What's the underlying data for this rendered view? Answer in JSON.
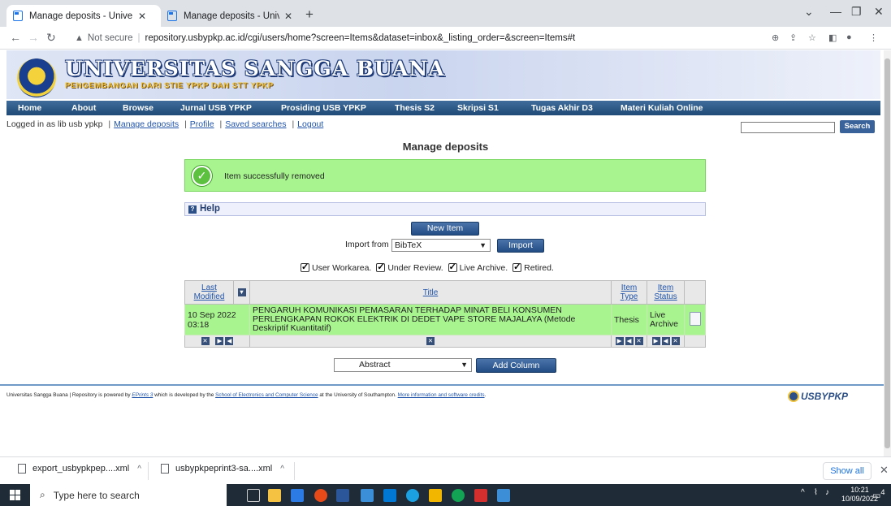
{
  "browser": {
    "tabs": [
      {
        "label": "Manage deposits - Universitas Sa",
        "active": true
      },
      {
        "label": "Manage deposits - Universitas Sa",
        "active": false
      }
    ],
    "security_label": "Not secure",
    "url": "repository.usbypkp.ac.id/cgi/users/home?screen=Items&dataset=inbox&_listing_order=&screen=Items#t"
  },
  "site": {
    "name": "UNIVERSITAS SANGGA BUANA",
    "tagline": "PENGEMBANGAN DARI STIE YPKP DAN STT YPKP",
    "menu": [
      "Home",
      "About",
      "Browse",
      "Jurnal USB YPKP",
      "Prosiding USB YPKP",
      "Thesis S2",
      "Skripsi S1",
      "Tugas Akhir D3",
      "Materi Kuliah Online"
    ],
    "login_text": "Logged in as lib usb ypkp",
    "user_links": [
      "Manage deposits",
      "Profile",
      "Saved searches",
      "Logout"
    ],
    "search_button": "Search"
  },
  "main": {
    "title": "Manage deposits",
    "success_message": "Item successfully removed",
    "help_label": "Help",
    "new_item_label": "New Item",
    "import_from_label": "Import from",
    "import_selected": "BibTeX",
    "import_button": "Import",
    "filters": [
      "User Workarea.",
      "Under Review.",
      "Live Archive.",
      "Retired."
    ],
    "table": {
      "headers": [
        "Last Modified",
        "Title",
        "Item Type",
        "Item Status"
      ],
      "rows": [
        {
          "modified": "10 Sep 2022 03:18",
          "title": "PENGARUH KOMUNIKASI PEMASARAN TERHADAP MINAT BELI KONSUMEN PERLENGKAPAN ROKOK ELEKTRIK DI DEDET VAPE STORE MAJALAYA (Metode Deskriptif Kuantitatif)",
          "type": "Thesis",
          "status": "Live Archive"
        }
      ]
    },
    "column_select": "Abstract",
    "add_column_label": "Add Column"
  },
  "footer": {
    "t1": "Universitas Sangga Buana | Repository is powered by ",
    "l1": "EPrints 3",
    "t2": " which is developed by the ",
    "l2": "School of Electronics and Computer Science",
    "t3": " at the University of Southampton. ",
    "l3": "More information and software credits",
    "t4": ".",
    "logo_text": "USBYPKP"
  },
  "downloads": {
    "items": [
      "export_usbypkpep....xml",
      "usbypkpeprint3-sa....xml"
    ],
    "show_all": "Show all"
  },
  "taskbar": {
    "search_placeholder": "Type here to search",
    "time": "10:21",
    "date": "10/09/2022",
    "notification_count": "4"
  }
}
